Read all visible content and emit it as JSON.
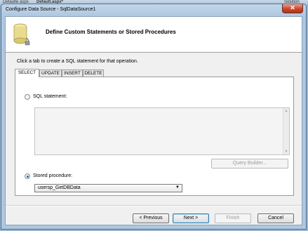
{
  "background": {
    "left_text": "Defaulte aspx",
    "mid_text": "Default.aspx*",
    "right_text": "Solution"
  },
  "window": {
    "title": "Configure Data Source - SqlDataSource1",
    "close_glyph": "✕"
  },
  "header": {
    "title": "Define Custom Statements or Stored Procedures",
    "icon": "database-icon"
  },
  "instruction": "Click a tab to create a SQL statement for that operation.",
  "tabs": [
    {
      "label": "SELECT",
      "active": true
    },
    {
      "label": "UPDATE",
      "active": false
    },
    {
      "label": "INSERT",
      "active": false
    },
    {
      "label": "DELETE",
      "active": false
    }
  ],
  "sql_statement": {
    "label": "SQL statement:",
    "selected": false,
    "value": ""
  },
  "query_builder_label": "Query Builder...",
  "stored_procedure": {
    "label": "Stored procedure:",
    "selected": true,
    "value": "usersp_GetDBData"
  },
  "buttons": {
    "previous": "< Previous",
    "next": "Next >",
    "finish": "Finish",
    "cancel": "Cancel"
  }
}
